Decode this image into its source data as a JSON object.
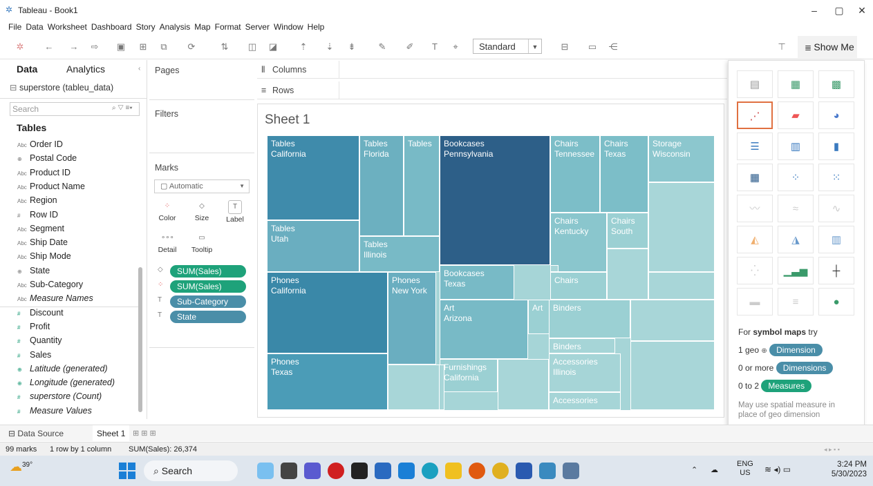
{
  "window": {
    "title": "Tableau - Book1",
    "controls": [
      "–",
      "▢",
      "✕"
    ]
  },
  "menu": [
    "File",
    "Data",
    "Worksheet",
    "Dashboard",
    "Story",
    "Analysis",
    "Map",
    "Format",
    "Server",
    "Window",
    "Help"
  ],
  "toolbar": {
    "fit_select": "Standard",
    "show_me_label": "Show Me"
  },
  "datapane": {
    "tab_data": "Data",
    "tab_analytics": "Analytics",
    "datasource": "superstore (tableu_data)",
    "search_placeholder": "Search",
    "tables_heading": "Tables",
    "dimensions": [
      {
        "icon": "Abc",
        "name": "Order ID"
      },
      {
        "icon": "⊕",
        "name": "Postal Code"
      },
      {
        "icon": "Abc",
        "name": "Product ID"
      },
      {
        "icon": "Abc",
        "name": "Product Name"
      },
      {
        "icon": "Abc",
        "name": "Region"
      },
      {
        "icon": "#",
        "name": "Row ID"
      },
      {
        "icon": "Abc",
        "name": "Segment"
      },
      {
        "icon": "Abc",
        "name": "Ship Date"
      },
      {
        "icon": "Abc",
        "name": "Ship Mode"
      },
      {
        "icon": "⊕",
        "name": "State"
      },
      {
        "icon": "Abc",
        "name": "Sub-Category"
      },
      {
        "icon": "Abc",
        "name": "Measure Names"
      }
    ],
    "measures": [
      {
        "icon": "#",
        "name": "Discount"
      },
      {
        "icon": "#",
        "name": "Profit"
      },
      {
        "icon": "#",
        "name": "Quantity"
      },
      {
        "icon": "#",
        "name": "Sales"
      },
      {
        "icon": "⊕",
        "name": "Latitude (generated)"
      },
      {
        "icon": "⊕",
        "name": "Longitude (generated)"
      },
      {
        "icon": "#",
        "name": "superstore (Count)"
      },
      {
        "icon": "#",
        "name": "Measure Values"
      }
    ]
  },
  "shelves": {
    "pages": "Pages",
    "filters": "Filters",
    "marks": "Marks",
    "mark_type": "Automatic",
    "columns": "Columns",
    "rows": "Rows",
    "mark_buttons": [
      "Color",
      "Size",
      "Label",
      "Detail",
      "Tooltip"
    ],
    "mark_pills": [
      "SUM(Sales)",
      "SUM(Sales)",
      "Sub-Category",
      "State"
    ]
  },
  "sheet": {
    "title": "Sheet 1"
  },
  "treemap": [
    {
      "line1": "Tables",
      "line2": "California",
      "color": "#3f8bab"
    },
    {
      "line1": "Tables",
      "line2": "Florida",
      "color": "#6cb0c0"
    },
    {
      "line1": "Tables",
      "line2": "",
      "color": "#78bac6"
    },
    {
      "line1": "Tables",
      "line2": "Utah",
      "color": "#6aaec0"
    },
    {
      "line1": "Tables",
      "line2": "Illinois",
      "color": "#78bac6"
    },
    {
      "line1": "Bookcases",
      "line2": "Pennsylvania",
      "color": "#2d5f88"
    },
    {
      "line1": "Bookcases",
      "line2": "Texas",
      "color": "#78bac6"
    },
    {
      "line1": "Chairs",
      "line2": "Tennessee",
      "color": "#7cbec8"
    },
    {
      "line1": "Chairs",
      "line2": "Texas",
      "color": "#7cbec8"
    },
    {
      "line1": "Storage",
      "line2": "Wisconsin",
      "color": "#8cc7ce"
    },
    {
      "line1": "Chairs",
      "line2": "Kentucky",
      "color": "#8ac6cd"
    },
    {
      "line1": "Chairs",
      "line2": "South",
      "color": "#9bd0d3"
    },
    {
      "line1": "Chairs",
      "line2": "",
      "color": "#9bd0d3"
    },
    {
      "line1": "Phones",
      "line2": "California",
      "color": "#3a88a8"
    },
    {
      "line1": "Phones",
      "line2": "New York",
      "color": "#6aaec0"
    },
    {
      "line1": "Phones",
      "line2": "Texas",
      "color": "#4b9cb7"
    },
    {
      "line1": "Art",
      "line2": "Arizona",
      "color": "#78bac6"
    },
    {
      "line1": "Art",
      "line2": "",
      "color": "#9bd0d3"
    },
    {
      "line1": "Binders",
      "line2": "",
      "color": "#9bd0d3"
    },
    {
      "line1": "Binders",
      "line2": "",
      "color": "#a6d5d7"
    },
    {
      "line1": "Furnishings",
      "line2": "California",
      "color": "#9bd0d3"
    },
    {
      "line1": "Accessories",
      "line2": "Illinois",
      "color": "#a6d5d7"
    },
    {
      "line1": "Accessories",
      "line2": "",
      "color": "#a6d5d7"
    }
  ],
  "showme": {
    "hint_prefix": "For",
    "hint_bold": "symbol maps",
    "hint_suffix": "try",
    "req1_text": "1 geo",
    "req1_pill": "Dimension",
    "req2_text": "0 or more",
    "req2_pill": "Dimensions",
    "req3_text": "0 to 2",
    "req3_pill": "Measures",
    "note": "May use spatial measure in place of geo dimension"
  },
  "bottom": {
    "data_source_tab": "Data Source",
    "sheet_tab": "Sheet 1"
  },
  "status": {
    "marks": "99 marks",
    "rowcol": "1 row by 1 column",
    "sum": "SUM(Sales): 26,374"
  },
  "taskbar": {
    "weather": "39°",
    "search": "Search",
    "lang1": "ENG",
    "lang2": "US",
    "time": "3:24 PM",
    "date": "5/30/2023"
  }
}
